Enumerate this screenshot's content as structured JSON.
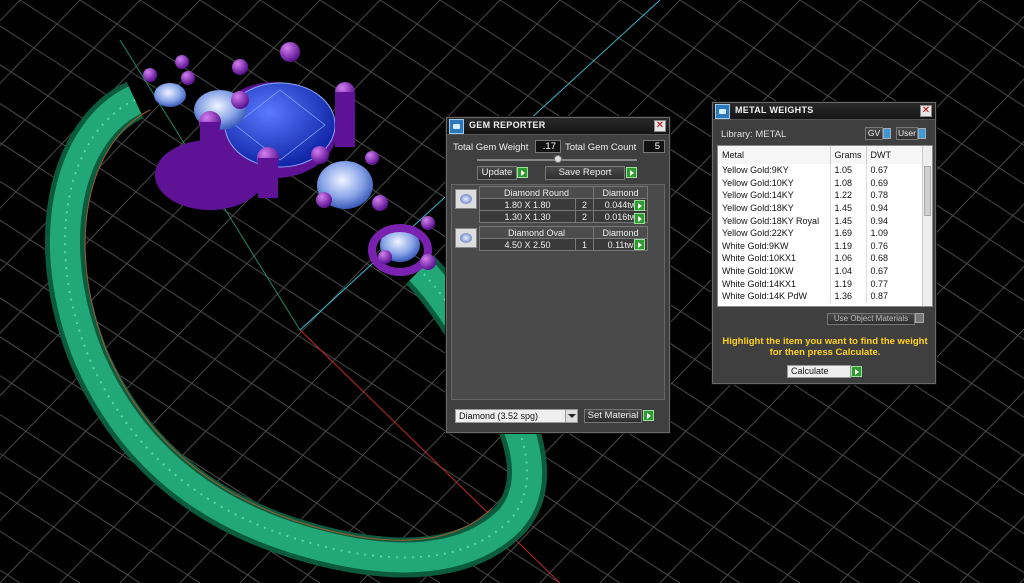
{
  "gem_reporter": {
    "title": "GEM REPORTER",
    "total_weight_label": "Total Gem Weight",
    "total_weight_value": ".17",
    "total_count_label": "Total Gem Count",
    "total_count_value": "5",
    "update_label": "Update",
    "save_report_label": "Save Report",
    "groups": [
      {
        "shape": "Diamond Round",
        "material": "Diamond",
        "rows": [
          {
            "size": "1.80 X 1.80",
            "count": "2",
            "weight": "0.044tw"
          },
          {
            "size": "1.30 X 1.30",
            "count": "2",
            "weight": "0.016tw"
          }
        ]
      },
      {
        "shape": "Diamond Oval",
        "material": "Diamond",
        "rows": [
          {
            "size": "4.50 X 2.50",
            "count": "1",
            "weight": "0.11tw"
          }
        ]
      }
    ],
    "material_select": "Diamond     (3.52 spg)",
    "set_material_label": "Set Material"
  },
  "metal_weights": {
    "title": "METAL WEIGHTS",
    "library_label": "Library: METAL",
    "gv_label": "GV",
    "user_label": "User",
    "columns": [
      "Metal",
      "Grams",
      "DWT"
    ],
    "rows": [
      {
        "metal": "Yellow Gold:9KY",
        "grams": "1.05",
        "dwt": "0.67"
      },
      {
        "metal": "Yellow Gold:10KY",
        "grams": "1.08",
        "dwt": "0.69"
      },
      {
        "metal": "Yellow Gold:14KY",
        "grams": "1.22",
        "dwt": "0.78"
      },
      {
        "metal": "Yellow Gold:18KY",
        "grams": "1.45",
        "dwt": "0.94"
      },
      {
        "metal": "Yellow Gold:18KY Royal",
        "grams": "1.45",
        "dwt": "0.94"
      },
      {
        "metal": "Yellow Gold:22KY",
        "grams": "1.69",
        "dwt": "1.09"
      },
      {
        "metal": "White Gold:9KW",
        "grams": "1.19",
        "dwt": "0.76"
      },
      {
        "metal": "White Gold:10KX1",
        "grams": "1.06",
        "dwt": "0.68"
      },
      {
        "metal": "White Gold:10KW",
        "grams": "1.04",
        "dwt": "0.67"
      },
      {
        "metal": "White Gold:14KX1",
        "grams": "1.19",
        "dwt": "0.77"
      },
      {
        "metal": "White Gold:14K PdW",
        "grams": "1.36",
        "dwt": "0.87"
      }
    ],
    "use_object_materials_label": "Use Object Materials",
    "hint_line1": "Highlight the item you want to find the weight",
    "hint_line2": "for then press Calculate.",
    "calculate_label": "Calculate"
  }
}
